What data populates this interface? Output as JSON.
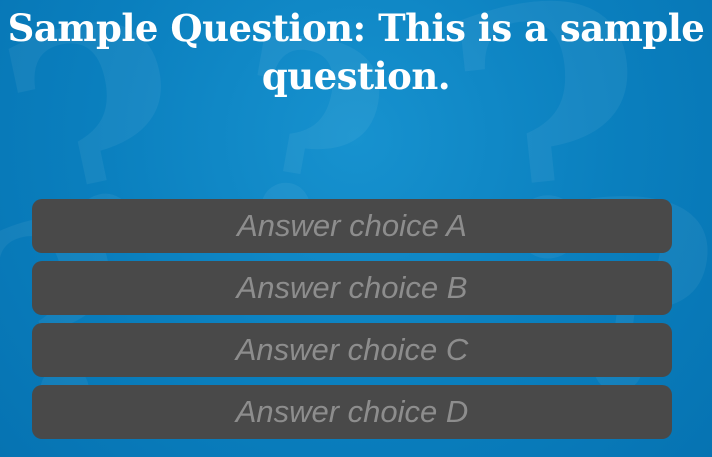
{
  "question": {
    "text": "Sample Question: This is a sample question."
  },
  "answers": [
    {
      "label": "Answer choice A"
    },
    {
      "label": "Answer choice B"
    },
    {
      "label": "Answer choice C"
    },
    {
      "label": "Answer choice D"
    }
  ],
  "colors": {
    "background": "#0f86c3",
    "question_text": "#ffffff",
    "answer_background": "#494949",
    "answer_text": "#8d8d8d"
  }
}
